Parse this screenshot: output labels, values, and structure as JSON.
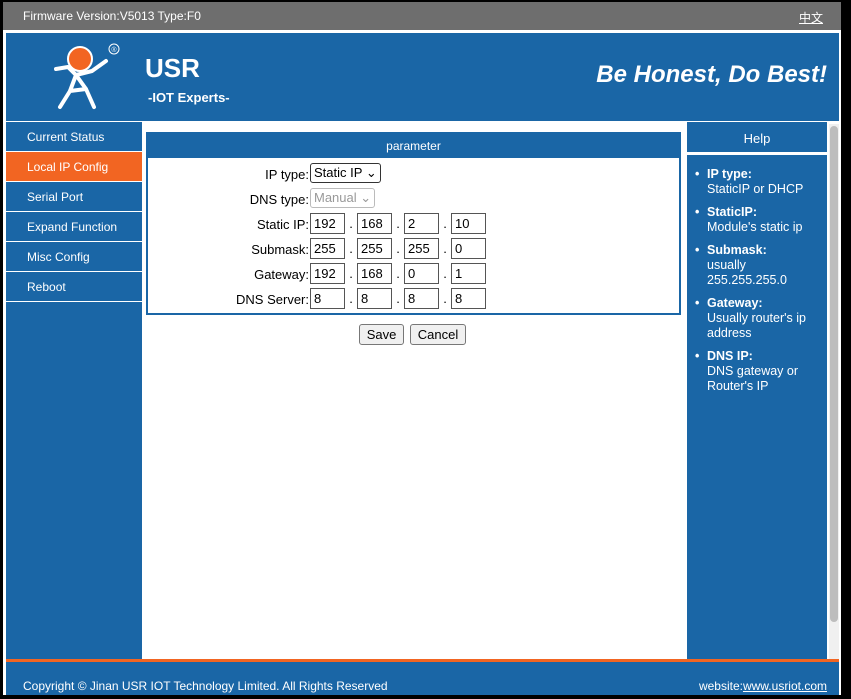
{
  "topbar": {
    "firmware": "Firmware Version:V5013 Type:F0",
    "lang": "中文"
  },
  "banner": {
    "brand": "USR",
    "tagline": "-IOT Experts-",
    "slogan": "Be Honest, Do Best!",
    "logo_icon": "usr-person-logo-icon",
    "registered": "®"
  },
  "sidebar": {
    "items": [
      {
        "label": "Current Status",
        "active": false
      },
      {
        "label": "Local IP Config",
        "active": true
      },
      {
        "label": "Serial Port",
        "active": false
      },
      {
        "label": "Expand Function",
        "active": false
      },
      {
        "label": "Misc Config",
        "active": false
      },
      {
        "label": "Reboot",
        "active": false
      }
    ]
  },
  "form": {
    "title": "parameter",
    "ip_type": {
      "label": "IP type:",
      "value": "Static IP"
    },
    "dns_type": {
      "label": "DNS type:",
      "value": "Manual"
    },
    "static_ip": {
      "label": "Static IP:",
      "octets": [
        "192",
        "168",
        "2",
        "10"
      ]
    },
    "submask": {
      "label": "Submask:",
      "octets": [
        "255",
        "255",
        "255",
        "0"
      ]
    },
    "gateway": {
      "label": "Gateway:",
      "octets": [
        "192",
        "168",
        "0",
        "1"
      ]
    },
    "dns_server": {
      "label": "DNS Server:",
      "octets": [
        "8",
        "8",
        "8",
        "8"
      ]
    },
    "save": "Save",
    "cancel": "Cancel"
  },
  "help": {
    "title": "Help",
    "items": [
      {
        "term": "IP type:",
        "desc": "StaticIP or DHCP"
      },
      {
        "term": "StaticIP:",
        "desc": "Module's static ip"
      },
      {
        "term": "Submask:",
        "desc": "usually 255.255.255.0"
      },
      {
        "term": "Gateway:",
        "desc": "Usually router's ip address"
      },
      {
        "term": "DNS IP:",
        "desc": "DNS gateway or Router's IP"
      }
    ]
  },
  "footer": {
    "copyright": "Copyright © Jinan USR IOT Technology Limited. All Rights Reserved",
    "website_label": "website:",
    "website_link": "www.usriot.com"
  },
  "colors": {
    "primary": "#1a66a6",
    "accent": "#f26522",
    "topbar": "#6e6e6e"
  }
}
